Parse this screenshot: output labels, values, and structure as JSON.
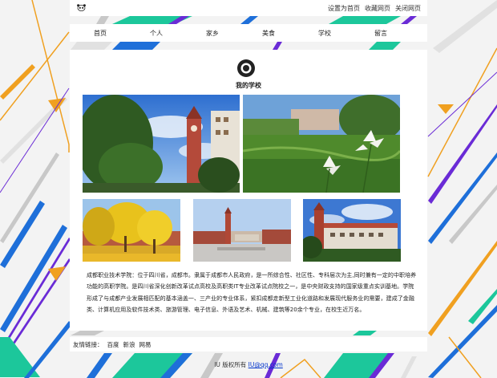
{
  "topbar": {
    "links": [
      "设置为首页",
      "收藏网页",
      "关闭网页"
    ]
  },
  "nav": {
    "items": [
      "首页",
      "个人",
      "家乡",
      "美食",
      "学校",
      "留言"
    ]
  },
  "main": {
    "title": "我的学校",
    "description": "成都职业技术学院：位于四川省，成都市。隶属于成都市人民政府，是一所综合性、社区性、专科层次为主,同时兼有一定的中职培养功能的高职学院。是四川省深化创新改革试点高校及高职类IT专业改革试点院校之一，是中央财政支持的国家级重点实训基地。学院形成了与成都产业发展相匹配的基本涵盖一、三产业的专业体系，紧扣成都走新型工业化道路和发展现代服务业的需要，建成了金融类、计算机应用及软件技术类、旅游管理、电子信息、外语及艺术、机械、建筑等20余个专业，在校生近万名。"
  },
  "friends": {
    "label": "友情链接：",
    "links": [
      "百度",
      "新浪",
      "网易"
    ]
  },
  "footer": {
    "copyright": "IU 版权所有",
    "email": "IU@qq.com"
  },
  "colors": {
    "teal": "#1cc79b",
    "blue": "#1e6fd9",
    "purple": "#6a2bd6",
    "orange": "#f0a020",
    "gray": "#c8c8c8"
  }
}
